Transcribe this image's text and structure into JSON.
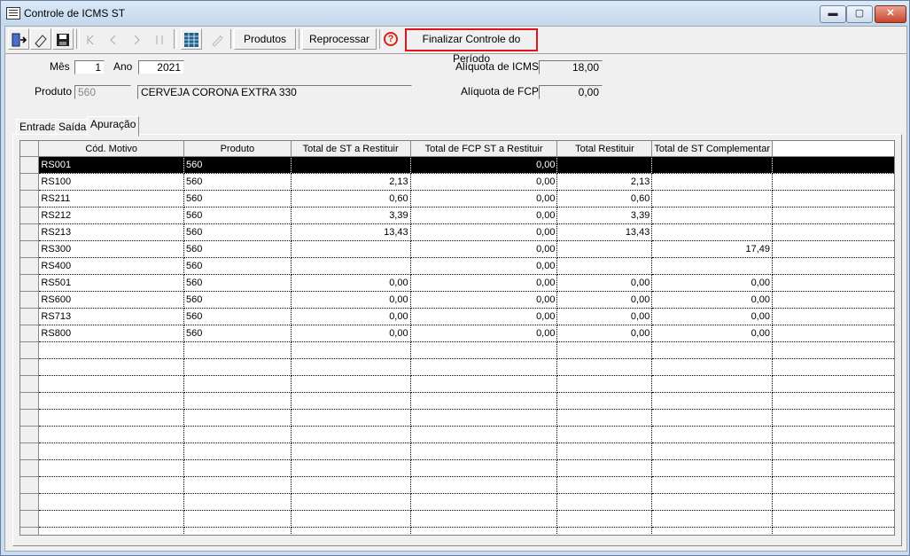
{
  "window": {
    "title": "Controle de ICMS ST",
    "minimize_glyph": "▬",
    "maximize_glyph": "▢",
    "close_glyph": "✕"
  },
  "toolbar": {
    "icons": [
      "exit-icon",
      "eraser-icon",
      "save-icon",
      "first-record-icon",
      "previous-record-icon",
      "next-record-icon",
      "last-record-icon",
      "spreadsheet-icon",
      "edit-disabled-icon"
    ],
    "produtos_label": "Produtos",
    "reprocessar_label": "Reprocessar",
    "help_glyph": "?",
    "finalizar_label": "Finalizar Controle do Período"
  },
  "form": {
    "mes_label": "Mês",
    "mes_value": "1",
    "ano_label": "Ano",
    "ano_value": "2021",
    "produto_label": "Produto",
    "produto_code": "560",
    "produto_desc": "CERVEJA CORONA EXTRA 330",
    "aliquota_icms_label": "Alíquota de ICMS",
    "aliquota_icms_value": "18,00",
    "aliquota_fcp_label": "Alíquota de FCP",
    "aliquota_fcp_value": "0,00"
  },
  "tabs": [
    "Entrada",
    "Saída",
    "Apuração"
  ],
  "active_tab": "Apuração",
  "grid": {
    "columns": [
      "Cód. Motivo",
      "Produto",
      "Total de ST a Restituir",
      "Total de FCP ST a Restituir",
      "Total Restituir",
      "Total de ST Complementar"
    ],
    "rows": [
      [
        "RS001",
        "560",
        "",
        "0,00",
        "",
        ""
      ],
      [
        "RS100",
        "560",
        "2,13",
        "0,00",
        "2,13",
        ""
      ],
      [
        "RS211",
        "560",
        "0,60",
        "0,00",
        "0,60",
        ""
      ],
      [
        "RS212",
        "560",
        "3,39",
        "0,00",
        "3,39",
        ""
      ],
      [
        "RS213",
        "560",
        "13,43",
        "0,00",
        "13,43",
        ""
      ],
      [
        "RS300",
        "560",
        "",
        "0,00",
        "",
        "17,49"
      ],
      [
        "RS400",
        "560",
        "",
        "0,00",
        "",
        ""
      ],
      [
        "RS501",
        "560",
        "0,00",
        "0,00",
        "0,00",
        "0,00"
      ],
      [
        "RS600",
        "560",
        "0,00",
        "0,00",
        "0,00",
        "0,00"
      ],
      [
        "RS713",
        "560",
        "0,00",
        "0,00",
        "0,00",
        "0,00"
      ],
      [
        "RS800",
        "560",
        "0,00",
        "0,00",
        "0,00",
        "0,00"
      ]
    ],
    "selected_row": 0,
    "blank_rows": 13
  },
  "colors": {
    "highlight": "#e0141b",
    "selection": "#000000",
    "help": "#d21111"
  }
}
